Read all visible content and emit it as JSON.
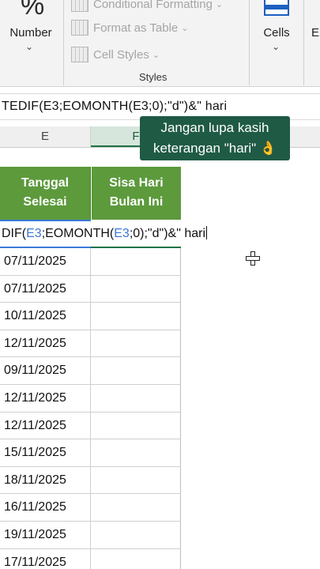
{
  "ribbon": {
    "number": {
      "icon": "percent-icon",
      "glyph": "%",
      "label": "Number",
      "chevron": "⌄"
    },
    "styles_group": {
      "conditional_formatting": "Conditional Formatting",
      "format_as_table": "Format as Table",
      "cell_styles": "Cell Styles",
      "label": "Styles"
    },
    "cells": {
      "icon": "cells-icon",
      "label": "Cells",
      "chevron": "⌄"
    },
    "editing_partial": "E"
  },
  "formula_bar": {
    "text": "TEDIF(E3;EOMONTH(E3;0);\"d\")&\" hari"
  },
  "columns": {
    "e": "E",
    "f": "F"
  },
  "tooltip": {
    "line1": "Jangan lupa kasih",
    "line2": "keterangan \"hari\" 👌"
  },
  "table_headers": {
    "e_line1": "Tanggal",
    "e_line2": "Selesai",
    "f_line1": "Sisa Hari",
    "f_line2": "Bulan Ini"
  },
  "edit_cell": {
    "p1": "DIF(",
    "r1": "E3",
    "p2": ";EOMONTH(",
    "r2": "E3",
    "p3": ";0);\"d\")&\" hari"
  },
  "rows": [
    "07/11/2025",
    "07/11/2025",
    "10/11/2025",
    "12/11/2025",
    "09/11/2025",
    "12/11/2025",
    "12/11/2025",
    "15/11/2025",
    "18/11/2025",
    "16/11/2025",
    "19/11/2025",
    "17/11/2025"
  ],
  "colors": {
    "header_green": "#5c9a3c",
    "tooltip_bg": "#1f5a45",
    "ref_blue": "#3c78d8",
    "excel_green": "#217346"
  }
}
